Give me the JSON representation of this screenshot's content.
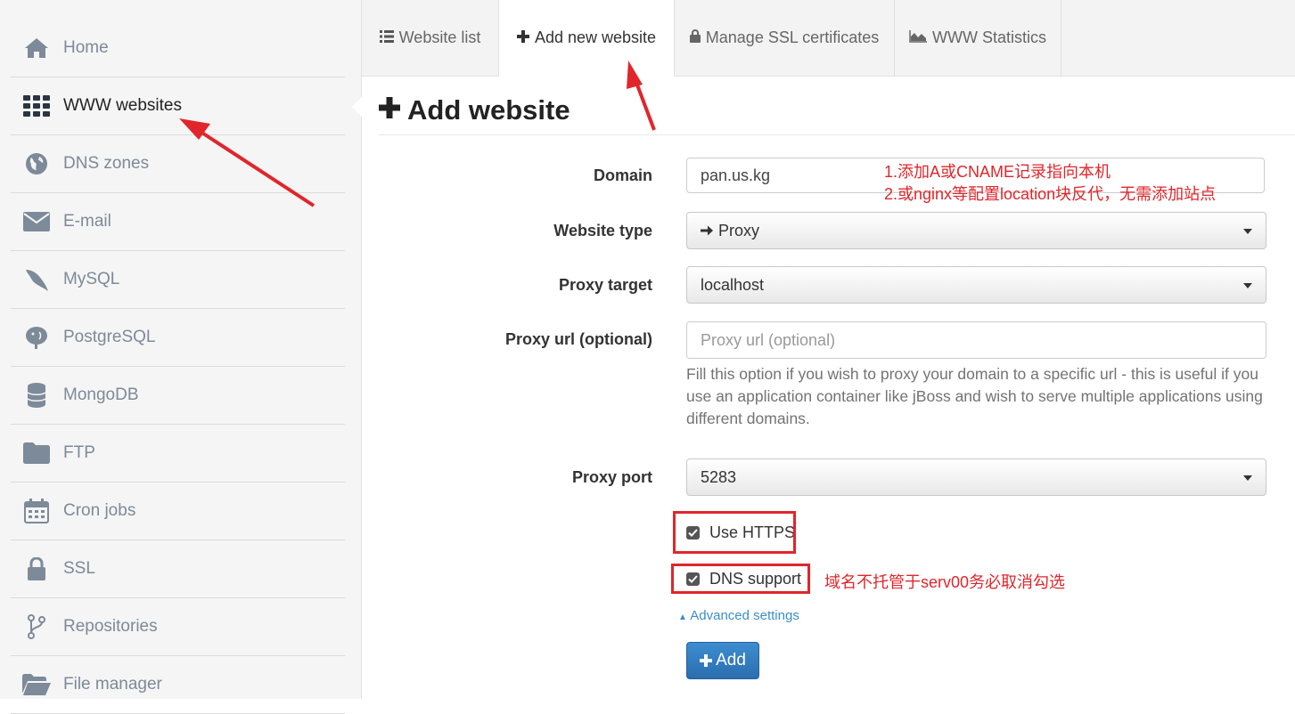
{
  "sidebar": {
    "items": [
      {
        "label": "Home",
        "icon": "home-icon"
      },
      {
        "label": "WWW websites",
        "icon": "grid-icon",
        "active": true
      },
      {
        "label": "DNS zones",
        "icon": "globe-icon"
      },
      {
        "label": "E-mail",
        "icon": "envelope-icon"
      },
      {
        "label": "MySQL",
        "icon": "dolphin-icon"
      },
      {
        "label": "PostgreSQL",
        "icon": "elephant-icon"
      },
      {
        "label": "MongoDB",
        "icon": "database-icon"
      },
      {
        "label": "FTP",
        "icon": "folder-icon"
      },
      {
        "label": "Cron jobs",
        "icon": "calendar-icon"
      },
      {
        "label": "SSL",
        "icon": "lock-icon"
      },
      {
        "label": "Repositories",
        "icon": "branch-icon"
      },
      {
        "label": "File manager",
        "icon": "folder-open-icon"
      }
    ]
  },
  "tabs": [
    {
      "label": "Website list",
      "icon": "list-icon"
    },
    {
      "label": "Add new website",
      "icon": "plus-icon",
      "active": true
    },
    {
      "label": "Manage SSL certificates",
      "icon": "lock-icon"
    },
    {
      "label": "WWW Statistics",
      "icon": "area-chart-icon"
    }
  ],
  "page": {
    "title": "Add website"
  },
  "form": {
    "domain_label": "Domain",
    "domain_value": "pan.us.kg",
    "website_type_label": "Website type",
    "website_type_value": "Proxy",
    "proxy_target_label": "Proxy target",
    "proxy_target_value": "localhost",
    "proxy_url_label": "Proxy url (optional)",
    "proxy_url_placeholder": "Proxy url (optional)",
    "proxy_url_help": "Fill this option if you wish to proxy your domain to a specific url - this is useful if you use an application container like jBoss and wish to serve multiple applications using different domains.",
    "proxy_port_label": "Proxy port",
    "proxy_port_value": "5283",
    "use_https_label": "Use HTTPS",
    "use_https_checked": true,
    "dns_support_label": "DNS support",
    "dns_support_checked": true,
    "advanced_settings_label": "Advanced settings",
    "add_button_label": "Add"
  },
  "annotations": {
    "note1": "1.添加A或CNAME记录指向本机",
    "note2": "2.或nginx等配置location块反代，无需添加站点",
    "note3": "域名不托管于serv00务必取消勾选",
    "color": "#e0262b"
  },
  "colors": {
    "accent": "#2a6eaf",
    "link": "#3b8ec8",
    "sidebar_text": "#7d8a99"
  }
}
